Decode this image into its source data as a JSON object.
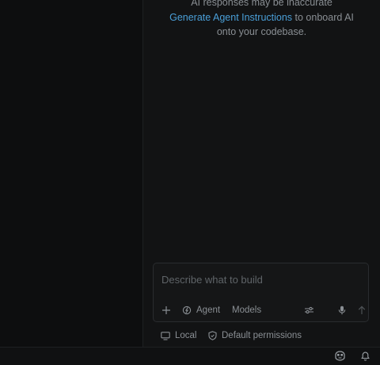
{
  "chat": {
    "notice_line1": "AI responses may be inaccurate",
    "notice_link": "Generate Agent Instructions",
    "notice_line2_rest": " to onboard AI",
    "notice_line3": "onto your codebase."
  },
  "composer": {
    "placeholder": "Describe what to build",
    "agent_label": "Agent",
    "models_label": "Models"
  },
  "status_row": {
    "local_label": "Local",
    "permissions_label": "Default permissions"
  },
  "icons": {
    "add": "plus-icon",
    "agent": "agent-icon",
    "settings": "sliders-icon",
    "mic": "microphone-icon",
    "send": "arrow-up-icon",
    "local": "monitor-icon",
    "permissions": "shield-icon",
    "copilot": "copilot-icon",
    "notifications": "bell-icon"
  },
  "colors": {
    "background": "#121314",
    "link": "#4a9fd8",
    "muted_text": "#8a8f94"
  }
}
